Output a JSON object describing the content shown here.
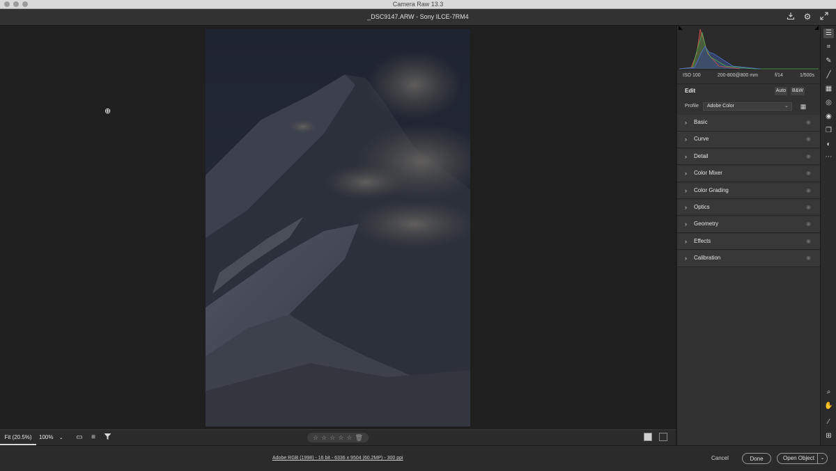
{
  "window": {
    "title": "Camera Raw 13.3"
  },
  "file": {
    "name": "_DSC9147.ARW  -  Sony ILCE-7RM4"
  },
  "histogram": {
    "exif": {
      "iso": "ISO 100",
      "lens": "200-800@800 mm",
      "aperture": "f/14",
      "shutter": "1/500s"
    }
  },
  "edit": {
    "title": "Edit",
    "auto_label": "Auto",
    "bw_label": "B&W",
    "profile_label": "Profile",
    "profile_value": "Adobe Color"
  },
  "sections": [
    {
      "label": "Basic"
    },
    {
      "label": "Curve"
    },
    {
      "label": "Detail"
    },
    {
      "label": "Color Mixer"
    },
    {
      "label": "Color Grading"
    },
    {
      "label": "Optics"
    },
    {
      "label": "Geometry"
    },
    {
      "label": "Effects"
    },
    {
      "label": "Calibration"
    }
  ],
  "bottom_toolbar": {
    "zoom_fit": "Fit (20.5%)",
    "zoom_pct": "100%"
  },
  "footer": {
    "info": "Adobe RGB (1998) - 16 bit - 6336 x 9504 (60.2MP) - 300 ppi",
    "cancel": "Cancel",
    "done": "Done",
    "open": "Open Object"
  },
  "icons": {
    "titlebar": [
      "save-icon",
      "settings-gear-icon",
      "fullscreen-icon"
    ],
    "toolstrip": [
      "edit-sliders-icon",
      "crop-icon",
      "spot-removal-icon",
      "adjustment-brush-icon",
      "graduated-filter-icon",
      "radial-filter-icon",
      "red-eye-icon",
      "snapshots-icon",
      "presets-icon",
      "more-icon",
      "zoom-icon",
      "hand-icon",
      "color-sampler-icon",
      "grid-overlay-icon"
    ]
  },
  "colors": {
    "panel": "#323232",
    "canvas": "#1f1f1f",
    "accent": "#d8d8d8"
  }
}
